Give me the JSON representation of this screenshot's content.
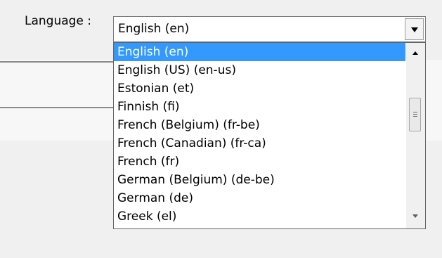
{
  "language_field": {
    "label": "Language :",
    "selected_value": "English (en)"
  },
  "dropdown": {
    "options": [
      "English (en)",
      "English (US) (en-us)",
      "Estonian (et)",
      "Finnish (fi)",
      "French (Belgium) (fr-be)",
      "French (Canadian) (fr-ca)",
      "French (fr)",
      "German (Belgium) (de-be)",
      "German (de)",
      "Greek (el)"
    ],
    "highlighted_index": 0
  },
  "colors": {
    "highlight": "#3399ff",
    "background": "#f0f0f0"
  }
}
